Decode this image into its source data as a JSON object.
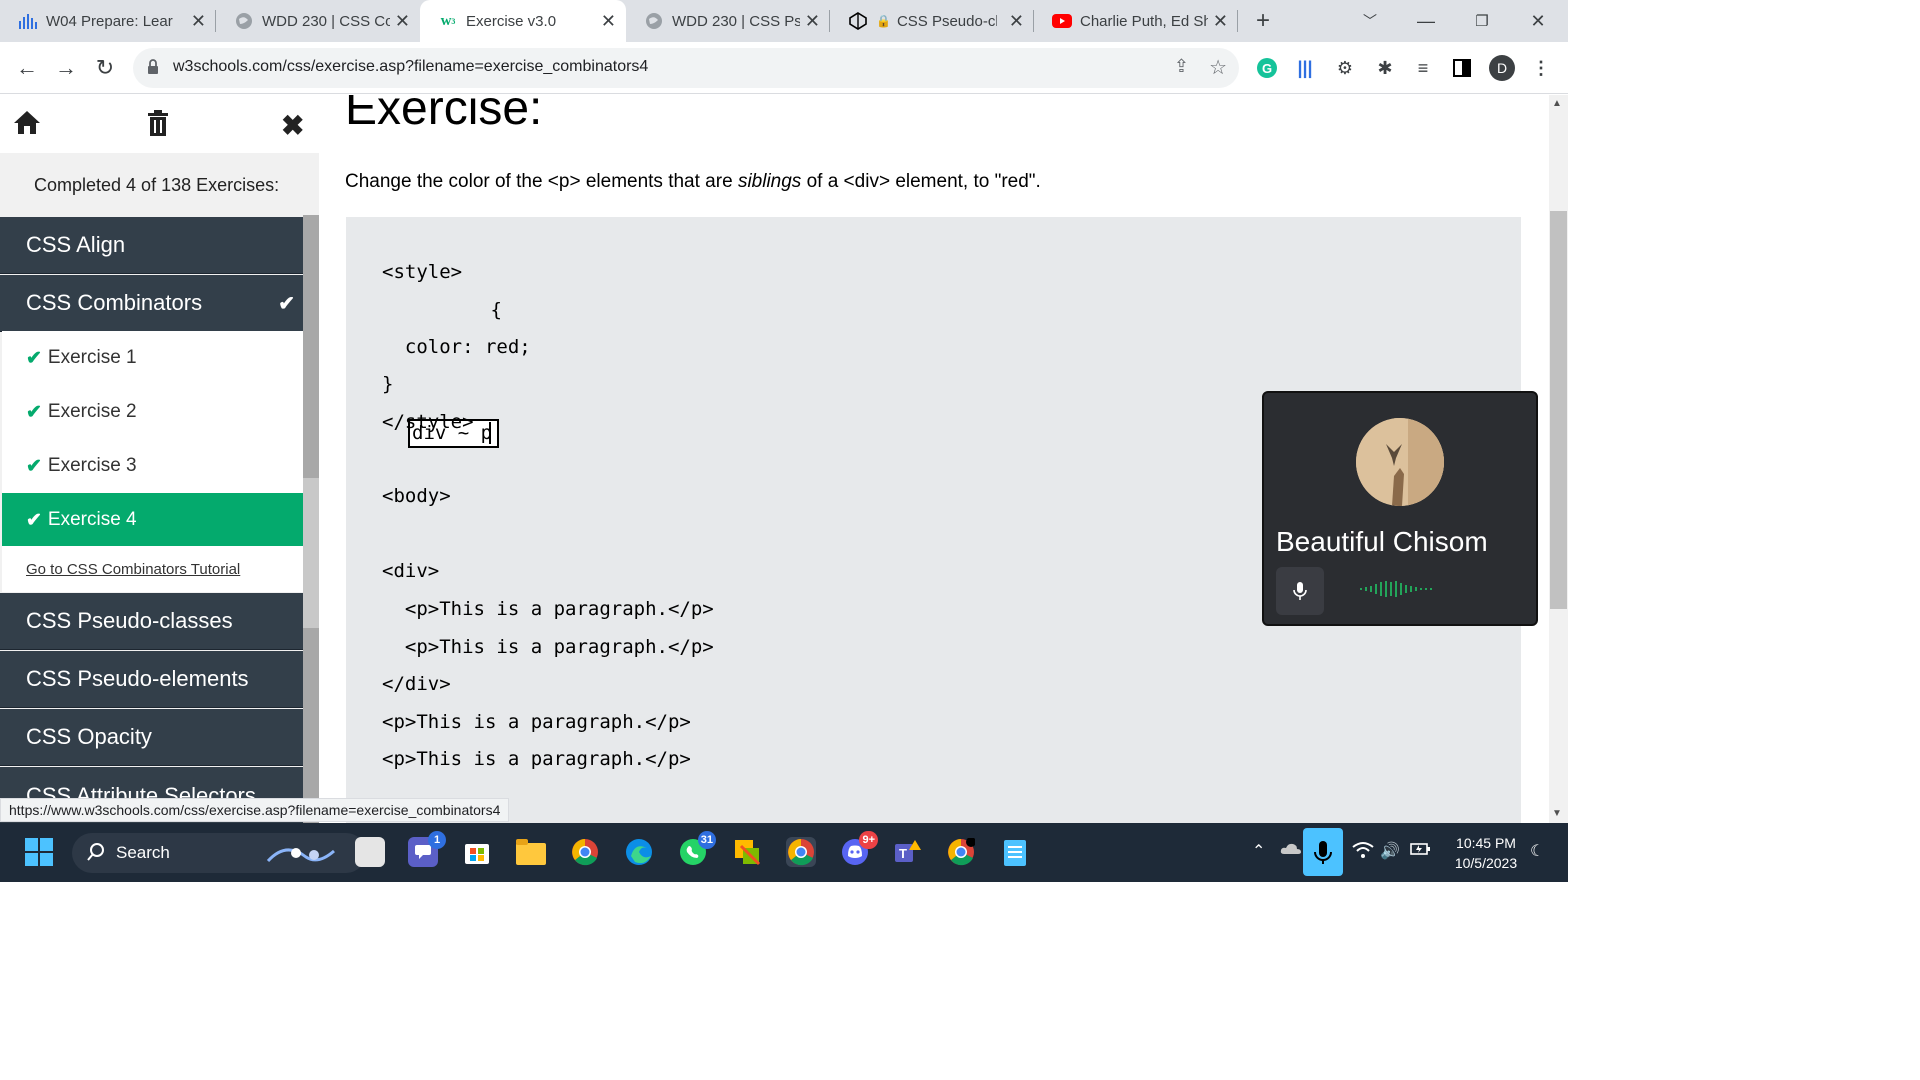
{
  "browser": {
    "tabs": [
      {
        "title": "W04 Prepare: Lear",
        "icon": "canvas-icon"
      },
      {
        "title": "WDD 230 | CSS Co",
        "icon": "globe-icon"
      },
      {
        "title": "Exercise v3.0",
        "icon": "w3schools-icon",
        "active": true
      },
      {
        "title": "WDD 230 | CSS Ps",
        "icon": "globe-icon"
      },
      {
        "title": "CSS Pseudo-cl",
        "icon": "codepen-icon"
      },
      {
        "title": "Charlie Puth, Ed Sh",
        "icon": "youtube-icon"
      }
    ],
    "url": "w3schools.com/css/exercise.asp?filename=exercise_combinators4",
    "profile_initial": "D"
  },
  "sidebar": {
    "progress": "Completed 4 of 138 Exercises:",
    "categories_top": [
      {
        "label": "CSS Align"
      },
      {
        "label": "CSS Combinators",
        "completed": true
      }
    ],
    "exercises": [
      {
        "label": "Exercise 1",
        "done": true
      },
      {
        "label": "Exercise 2",
        "done": true
      },
      {
        "label": "Exercise 3",
        "done": true
      },
      {
        "label": "Exercise 4",
        "done": true,
        "active": true
      }
    ],
    "tutorial_link": "Go to CSS Combinators Tutorial",
    "categories_bottom": [
      {
        "label": "CSS Pseudo-classes"
      },
      {
        "label": "CSS Pseudo-elements"
      },
      {
        "label": "CSS Opacity"
      },
      {
        "label": "CSS Attribute Selectors"
      }
    ]
  },
  "main": {
    "title": "Exercise:",
    "instruction_pre": "Change the color of the <p> elements that are ",
    "instruction_em": "siblings",
    "instruction_post": " of a <div> element, to \"red\".",
    "answer": "div ~ p",
    "code": {
      "style_open": "<style>",
      "brace_open": " {",
      "rule": "  color: red;",
      "brace_close": "}",
      "style_close": "</style>",
      "body_open": "<body>",
      "div_open": "<div>",
      "p1": "  <p>This is a paragraph.</p>",
      "p2": "  <p>This is a paragraph.</p>",
      "div_close": "</div>",
      "p3": "<p>This is a paragraph.</p>",
      "p4": "<p>This is a paragraph.</p>"
    }
  },
  "overlay": {
    "name": "Beautiful  Chisom"
  },
  "status_url": "https://www.w3schools.com/css/exercise.asp?filename=exercise_combinators4",
  "taskbar": {
    "search": "Search",
    "time": "10:45 PM",
    "date": "10/5/2023",
    "badges": {
      "teams_chat": "1",
      "whatsapp": "31",
      "discord": "9+"
    }
  },
  "colors": {
    "w3_green": "#04aa6d",
    "sidebar_dark": "#333f4a",
    "code_bg": "#e7e9eb"
  }
}
